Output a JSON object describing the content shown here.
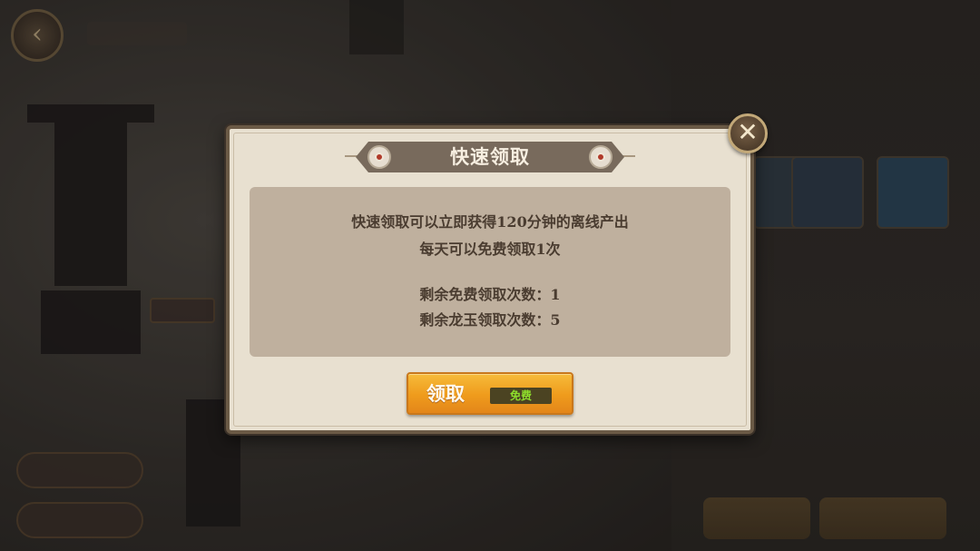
{
  "modal": {
    "title": "快速领取",
    "description_line1": "快速领取可以立即获得120分钟的离线产出",
    "description_line2": "每天可以免费领取1次",
    "remaining_free": "剩余免费领取次数：1",
    "remaining_jade": "剩余龙玉领取次数：5",
    "claim_label": "领取",
    "free_badge": "免费",
    "close_icon": "close-icon"
  },
  "colors": {
    "modal_background": "#e8e0d0",
    "content_panel": "#bfb09e",
    "title_banner": "#786a5c",
    "claim_button": "#ef9b1c",
    "free_badge_text": "#8ede2c"
  }
}
